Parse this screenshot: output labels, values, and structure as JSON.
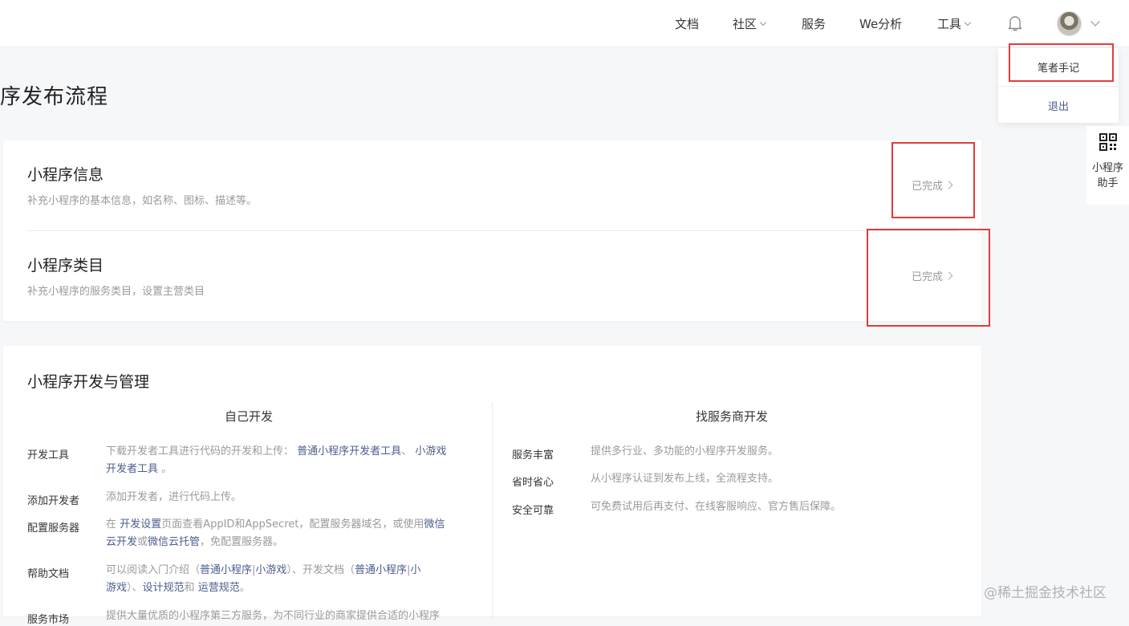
{
  "nav": {
    "docs": "文档",
    "community": "社区",
    "services": "服务",
    "we_analytics": "We分析",
    "tools": "工具"
  },
  "user_menu": {
    "notes": "笔者手记",
    "logout": "退出"
  },
  "helper": {
    "line1": "小程序",
    "line2": "助手"
  },
  "page_title": "序发布流程",
  "steps": [
    {
      "title": "小程序信息",
      "desc": "补充小程序的基本信息，如名称、图标、描述等。",
      "status": "已完成"
    },
    {
      "title": "小程序类目",
      "desc": "补充小程序的服务类目，设置主营类目",
      "status": "已完成"
    }
  ],
  "dev": {
    "title": "小程序开发与管理",
    "self_dev": {
      "heading": "自己开发",
      "tools_label": "开发工具",
      "tools_text": "下载开发者工具进行代码的开发和上传：",
      "tools_link1": "普通小程序开发者工具",
      "tools_sep": "、",
      "tools_link2a": "小游戏",
      "tools_link2b": "开发者工具",
      "tools_end": "。",
      "devs_label": "添加开发者",
      "devs_text": "添加开发者，进行代码上传。",
      "server_label": "配置服务器",
      "server_t1": "在",
      "server_link1": "开发设置",
      "server_t2": "页面查看AppID和AppSecret，配置服务器域名，或使用",
      "server_link2a": "微信",
      "server_link2b": "云开发",
      "server_t3": "或",
      "server_link3": "微信云托管",
      "server_t4": "，免配置服务器。",
      "help_label": "帮助文档",
      "help_t1": "可以阅读入门介绍（",
      "help_link1": "普通小程序",
      "help_sep": "|",
      "help_link2": "小游戏",
      "help_t2": "）、开发文档（",
      "help_link3": "普通小程序",
      "help_link4a": "小",
      "help_link4b": "游戏",
      "help_t3": "）、",
      "help_link5": "设计规范",
      "help_t4": "和",
      "help_link6": "运营规范",
      "help_t5": "。",
      "market_label": "服务市场",
      "market_text": "提供大量优质的小程序第三方服务，为不同行业的商家提供合适的小程序"
    },
    "vendor_dev": {
      "heading": "找服务商开发",
      "rows": [
        {
          "label": "服务丰富",
          "text": "提供多行业、多功能的小程序开发服务。"
        },
        {
          "label": "省时省心",
          "text": "从小程序认证到发布上线，全流程支持。"
        },
        {
          "label": "安全可靠",
          "text": "可免费试用后再支付、在线客服响应、官方售后保障。"
        }
      ]
    }
  },
  "watermark": "@稀土掘金技术社区",
  "colors": {
    "link": "#4c5d8e",
    "highlight_box": "#e03c3c"
  }
}
